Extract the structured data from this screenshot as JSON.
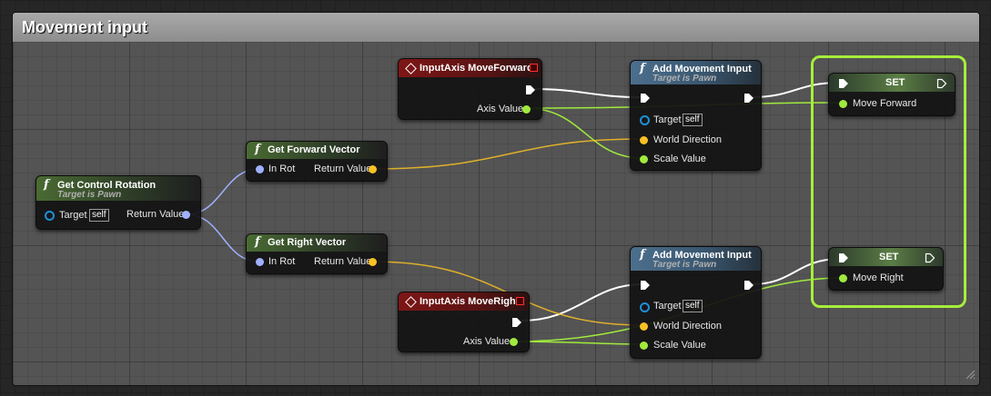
{
  "comment": {
    "title": "Movement input"
  },
  "colors": {
    "exec": "#ffffff",
    "float": "#a0ea3d",
    "rotator": "#9fb1ff",
    "vector": "#f8c124",
    "object": "#1e90d9",
    "highlight": "#a6ee3a"
  },
  "nodes": {
    "get_control_rotation": {
      "title": "Get Control Rotation",
      "subtitle": "Target is Pawn",
      "target_label": "Target",
      "target_value": "self",
      "return_label": "Return Value"
    },
    "get_forward_vector": {
      "title": "Get Forward Vector",
      "in_label": "In Rot",
      "return_label": "Return Value"
    },
    "get_right_vector": {
      "title": "Get Right Vector",
      "in_label": "In Rot",
      "return_label": "Return Value"
    },
    "input_axis_forward": {
      "title": "InputAxis MoveForward",
      "axis_label": "Axis Value"
    },
    "input_axis_right": {
      "title": "InputAxis MoveRight",
      "axis_label": "Axis Value"
    },
    "add_movement_1": {
      "title": "Add Movement Input",
      "subtitle": "Target is Pawn",
      "target_label": "Target",
      "target_value": "self",
      "world_label": "World Direction",
      "scale_label": "Scale Value"
    },
    "add_movement_2": {
      "title": "Add Movement Input",
      "subtitle": "Target is Pawn",
      "target_label": "Target",
      "target_value": "self",
      "world_label": "World Direction",
      "scale_label": "Scale Value"
    },
    "set_forward": {
      "title": "SET",
      "var_label": "Move Forward"
    },
    "set_right": {
      "title": "SET",
      "var_label": "Move Right"
    }
  }
}
